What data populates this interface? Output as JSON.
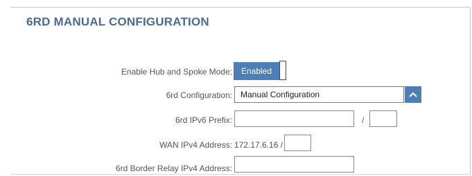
{
  "section": {
    "title": "6RD MANUAL CONFIGURATION"
  },
  "form": {
    "hub_spoke": {
      "label": "Enable Hub and Spoke Mode:",
      "value": "Enabled"
    },
    "config": {
      "label": "6rd Configuration:",
      "value": "Manual Configuration"
    },
    "prefix": {
      "label": "6rd IPv6 Prefix:",
      "value": "",
      "length": "",
      "separator": "/"
    },
    "wan": {
      "label": "WAN IPv4 Address:",
      "value": "172.17.6.16 /",
      "mask": ""
    },
    "relay": {
      "label": "6rd Border Relay IPv4 Address:",
      "value": ""
    }
  },
  "icons": {
    "select_toggle": "chevron-up-icon"
  },
  "colors": {
    "accent": "#4d7fb6",
    "title": "#4a6b8f"
  }
}
